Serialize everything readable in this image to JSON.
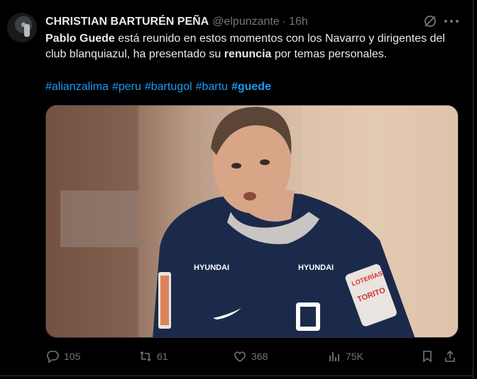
{
  "author": {
    "name": "CHRISTIAN BARTURÉN PEÑA",
    "handle": "@elpunzante",
    "separator": "·",
    "time": "16h",
    "avatar_icon": "avatar-photo"
  },
  "tweet": {
    "bold1": "Pablo Guede",
    "text1": " está reunido en estos momentos con los Navarro y dirigentes del club blanquiazul, ha presentado su ",
    "bold2": "renuncia",
    "text2": " por temas personales.",
    "hashtags": [
      "#alianzalima",
      "#peru",
      "#bartugol",
      "#bartu",
      "#guede"
    ]
  },
  "media": {
    "description_icon": "photo-of-man-in-blue-jersey",
    "jersey_text": [
      "HYUNDAI",
      "HYUNDAI",
      "LOTERÍAS",
      "TORITO"
    ]
  },
  "actions": {
    "replies": "105",
    "reposts": "61",
    "likes": "368",
    "views": "75K"
  },
  "colors": {
    "background": "#000000",
    "text": "#e7e9ea",
    "muted": "#71767b",
    "link": "#1d9bf0",
    "jersey": "#1b2a4a"
  }
}
